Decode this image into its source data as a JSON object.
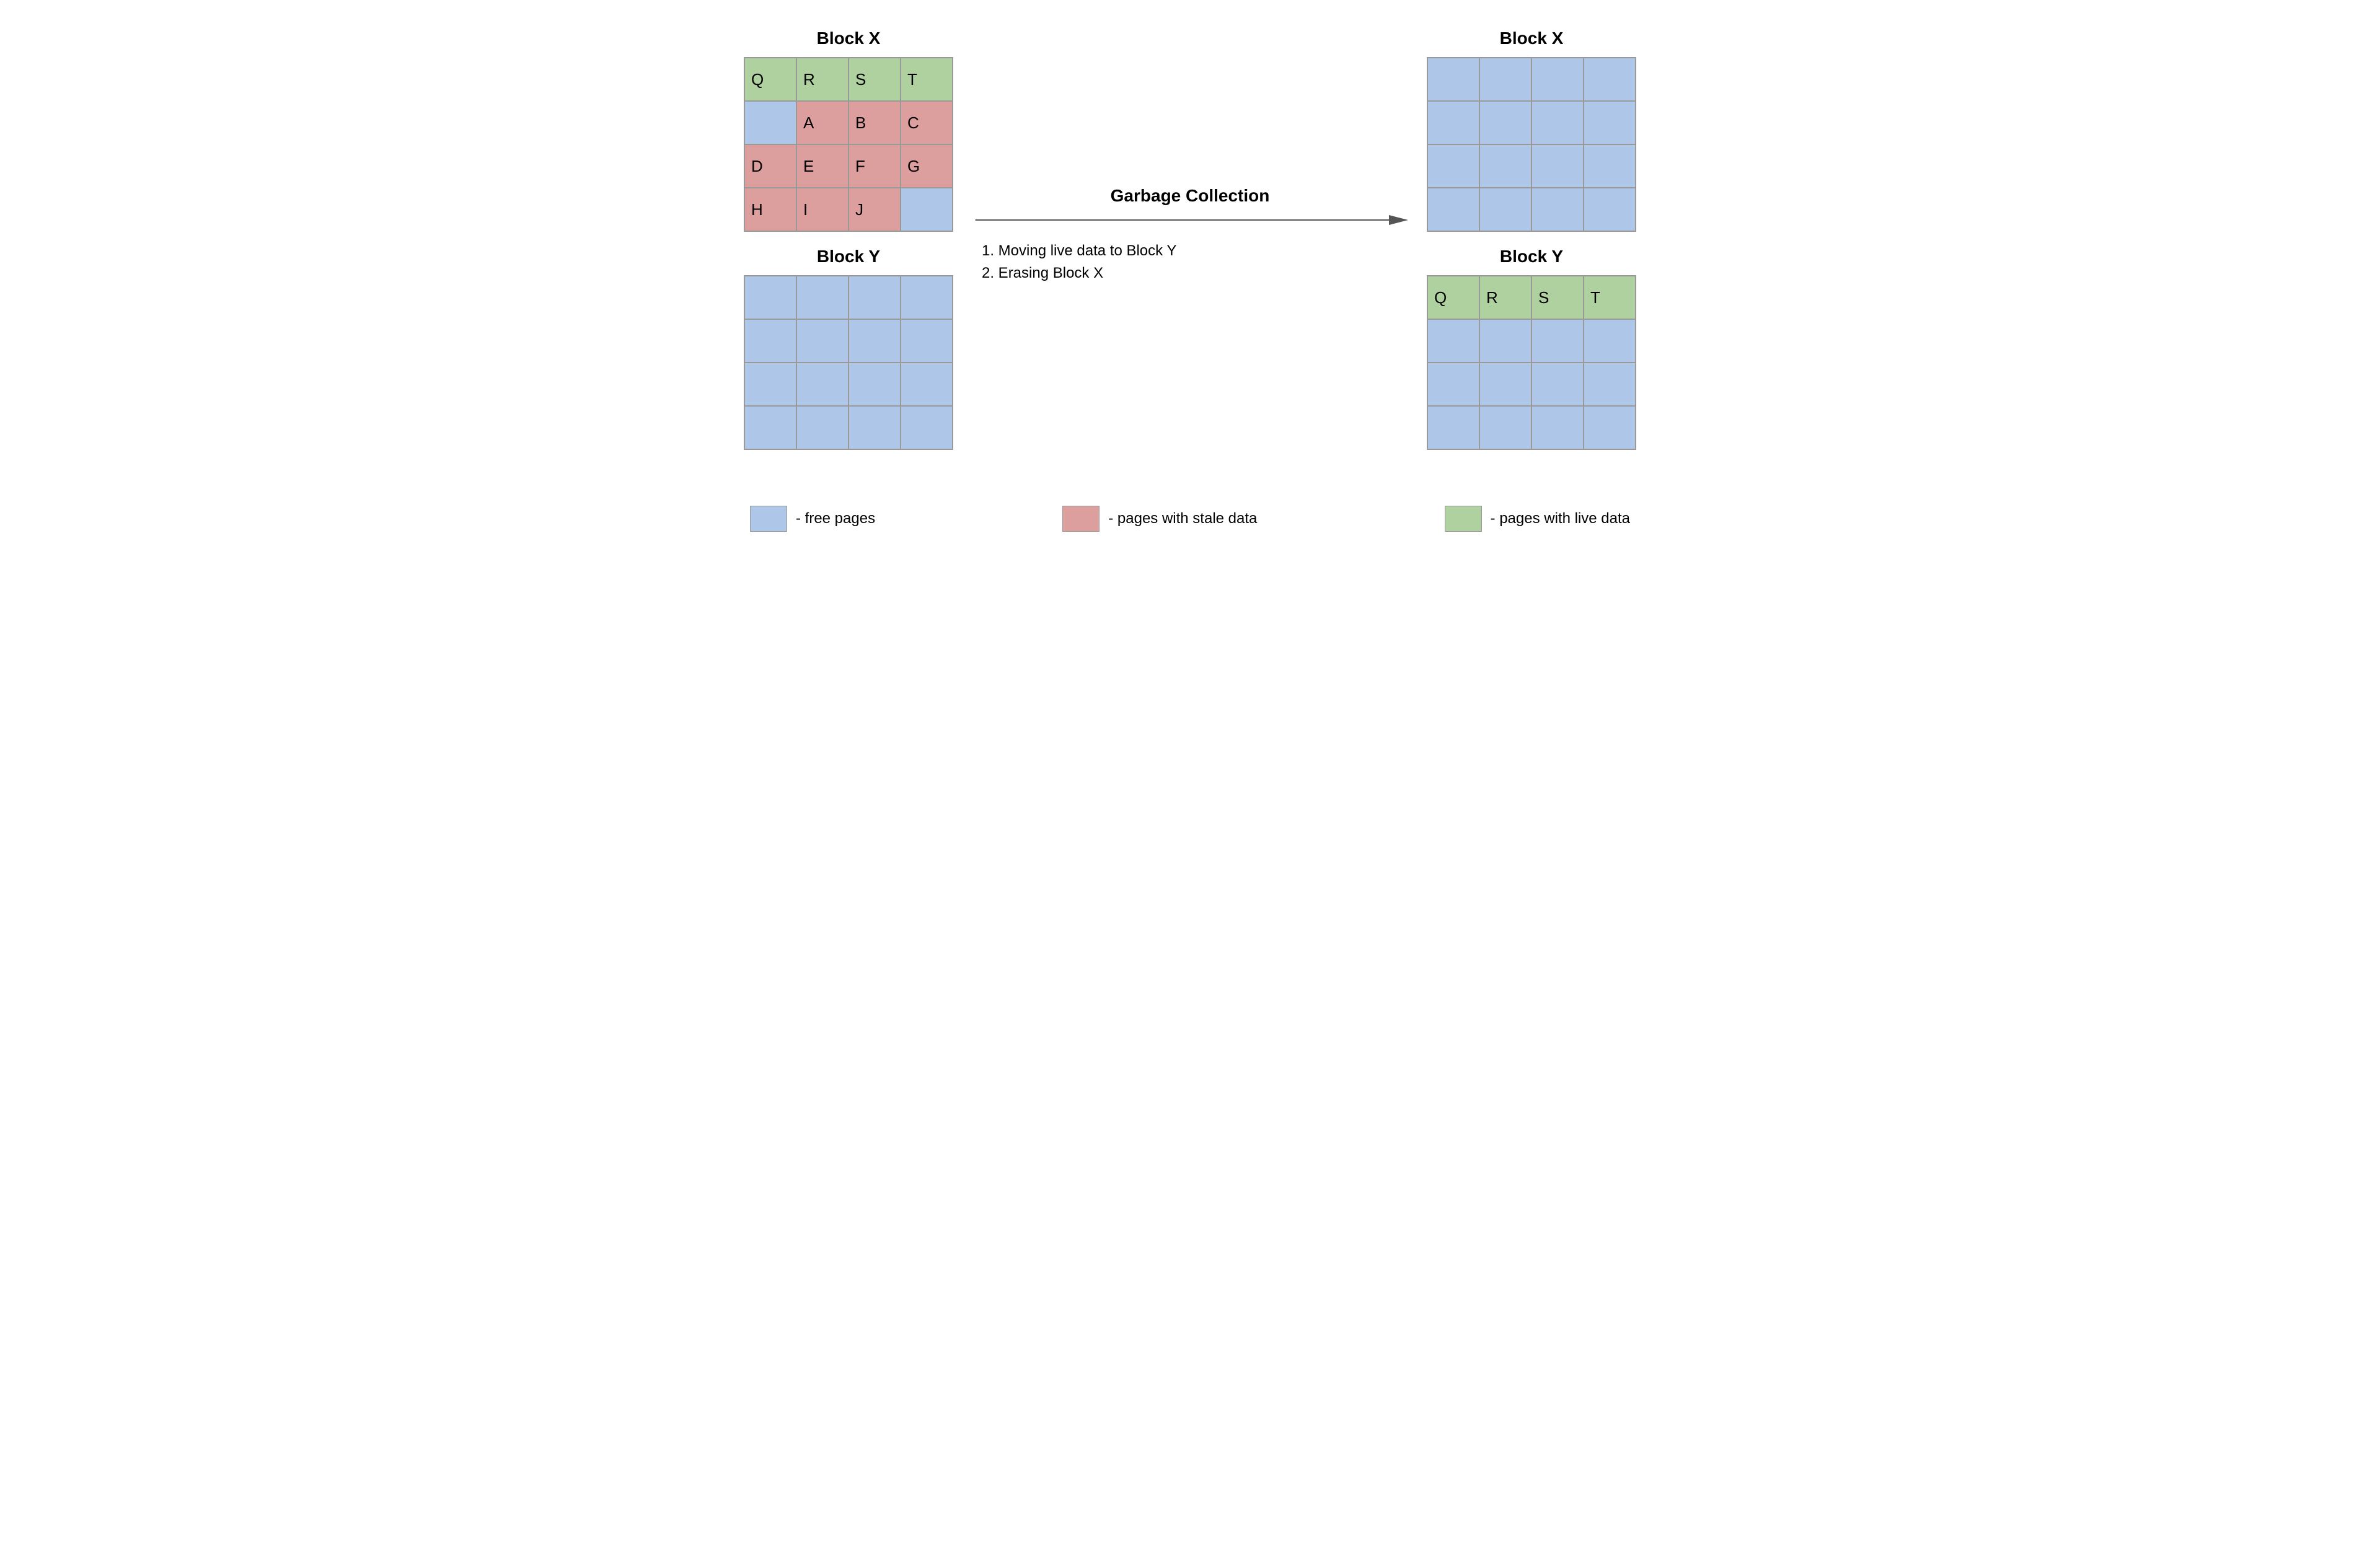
{
  "titles": {
    "left_x": "Block X",
    "left_y": "Block Y",
    "right_x": "Block X",
    "right_y": "Block Y"
  },
  "gc": {
    "heading": "Garbage Collection",
    "step1": "1. Moving live data to Block Y",
    "step2": "2. Erasing Block X"
  },
  "legend": {
    "free": "- free pages",
    "stale": "- pages with stale data",
    "live": "- pages with live data"
  },
  "colors": {
    "free": "#aec6e8",
    "stale": "#dd9e9e",
    "live": "#afd19f"
  },
  "chart_data": {
    "type": "table",
    "page_states": [
      "free",
      "stale",
      "live"
    ],
    "before": {
      "block_x": [
        [
          {
            "label": "Q",
            "state": "live"
          },
          {
            "label": "R",
            "state": "live"
          },
          {
            "label": "S",
            "state": "live"
          },
          {
            "label": "T",
            "state": "live"
          }
        ],
        [
          {
            "label": "",
            "state": "free"
          },
          {
            "label": "A",
            "state": "stale"
          },
          {
            "label": "B",
            "state": "stale"
          },
          {
            "label": "C",
            "state": "stale"
          }
        ],
        [
          {
            "label": "D",
            "state": "stale"
          },
          {
            "label": "E",
            "state": "stale"
          },
          {
            "label": "F",
            "state": "stale"
          },
          {
            "label": "G",
            "state": "stale"
          }
        ],
        [
          {
            "label": "H",
            "state": "stale"
          },
          {
            "label": "I",
            "state": "stale"
          },
          {
            "label": "J",
            "state": "stale"
          },
          {
            "label": "",
            "state": "free"
          }
        ]
      ],
      "block_y": [
        [
          {
            "label": "",
            "state": "free"
          },
          {
            "label": "",
            "state": "free"
          },
          {
            "label": "",
            "state": "free"
          },
          {
            "label": "",
            "state": "free"
          }
        ],
        [
          {
            "label": "",
            "state": "free"
          },
          {
            "label": "",
            "state": "free"
          },
          {
            "label": "",
            "state": "free"
          },
          {
            "label": "",
            "state": "free"
          }
        ],
        [
          {
            "label": "",
            "state": "free"
          },
          {
            "label": "",
            "state": "free"
          },
          {
            "label": "",
            "state": "free"
          },
          {
            "label": "",
            "state": "free"
          }
        ],
        [
          {
            "label": "",
            "state": "free"
          },
          {
            "label": "",
            "state": "free"
          },
          {
            "label": "",
            "state": "free"
          },
          {
            "label": "",
            "state": "free"
          }
        ]
      ]
    },
    "after": {
      "block_x": [
        [
          {
            "label": "",
            "state": "free"
          },
          {
            "label": "",
            "state": "free"
          },
          {
            "label": "",
            "state": "free"
          },
          {
            "label": "",
            "state": "free"
          }
        ],
        [
          {
            "label": "",
            "state": "free"
          },
          {
            "label": "",
            "state": "free"
          },
          {
            "label": "",
            "state": "free"
          },
          {
            "label": "",
            "state": "free"
          }
        ],
        [
          {
            "label": "",
            "state": "free"
          },
          {
            "label": "",
            "state": "free"
          },
          {
            "label": "",
            "state": "free"
          },
          {
            "label": "",
            "state": "free"
          }
        ],
        [
          {
            "label": "",
            "state": "free"
          },
          {
            "label": "",
            "state": "free"
          },
          {
            "label": "",
            "state": "free"
          },
          {
            "label": "",
            "state": "free"
          }
        ]
      ],
      "block_y": [
        [
          {
            "label": "Q",
            "state": "live"
          },
          {
            "label": "R",
            "state": "live"
          },
          {
            "label": "S",
            "state": "live"
          },
          {
            "label": "T",
            "state": "live"
          }
        ],
        [
          {
            "label": "",
            "state": "free"
          },
          {
            "label": "",
            "state": "free"
          },
          {
            "label": "",
            "state": "free"
          },
          {
            "label": "",
            "state": "free"
          }
        ],
        [
          {
            "label": "",
            "state": "free"
          },
          {
            "label": "",
            "state": "free"
          },
          {
            "label": "",
            "state": "free"
          },
          {
            "label": "",
            "state": "free"
          }
        ],
        [
          {
            "label": "",
            "state": "free"
          },
          {
            "label": "",
            "state": "free"
          },
          {
            "label": "",
            "state": "free"
          },
          {
            "label": "",
            "state": "free"
          }
        ]
      ]
    }
  }
}
